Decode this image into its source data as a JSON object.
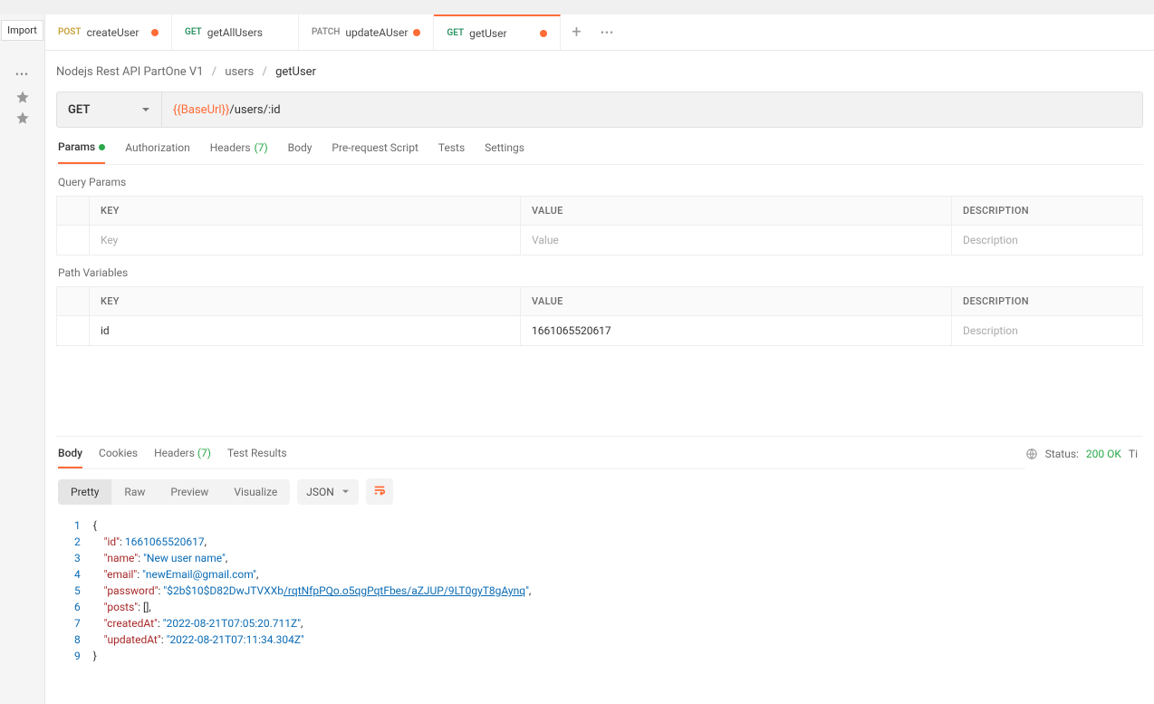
{
  "import_label": "Import",
  "tabs": [
    {
      "method": "POST",
      "method_class": "post",
      "label": "createUser",
      "unsaved": true
    },
    {
      "method": "GET",
      "method_class": "get",
      "label": "getAllUsers",
      "unsaved": false
    },
    {
      "method": "PATCH",
      "method_class": "patch",
      "label": "updateAUser",
      "unsaved": true
    },
    {
      "method": "GET",
      "method_class": "get",
      "label": "getUser",
      "unsaved": true
    }
  ],
  "active_tab": 3,
  "breadcrumb": {
    "parts": [
      "Nodejs Rest API PartOne V1",
      "users",
      "getUser"
    ]
  },
  "request": {
    "method": "GET",
    "url_var": "{{BaseUrl}}",
    "url_path": "/users/:id"
  },
  "req_tabs": {
    "params": "Params",
    "authorization": "Authorization",
    "headers": "Headers",
    "headers_count": "(7)",
    "body": "Body",
    "prerequest": "Pre-request Script",
    "tests": "Tests",
    "settings": "Settings"
  },
  "query_title": "Query Params",
  "path_title": "Path Variables",
  "grid_headers": {
    "key": "KEY",
    "value": "VALUE",
    "desc": "DESCRIPTION"
  },
  "placeholders": {
    "key": "Key",
    "value": "Value",
    "desc": "Description"
  },
  "path_vars": [
    {
      "key": "id",
      "value": "1661065520617",
      "desc": ""
    }
  ],
  "resp_tabs": {
    "body": "Body",
    "cookies": "Cookies",
    "headers": "Headers",
    "headers_count": "(7)",
    "test_results": "Test Results"
  },
  "status": {
    "label": "Status:",
    "code": "200 OK",
    "time_prefix": "Ti"
  },
  "view_modes": {
    "pretty": "Pretty",
    "raw": "Raw",
    "preview": "Preview",
    "visualize": "Visualize"
  },
  "format": "JSON",
  "response": {
    "id": 1661065520617,
    "name": "New user name",
    "email": "newEmail@gmail.com",
    "password_prefix": "$2b$10$D82DwJTVXXb",
    "password_link": "/rqtNfpPQo.o5qgPqtFbes/aZJUP/9LT0gyT8gAynq",
    "posts": "[]",
    "createdAt": "2022-08-21T07:05:20.711Z",
    "updatedAt": "2022-08-21T07:11:34.304Z"
  },
  "gutter": "1\n2\n3\n4\n5\n6\n7\n8\n9"
}
